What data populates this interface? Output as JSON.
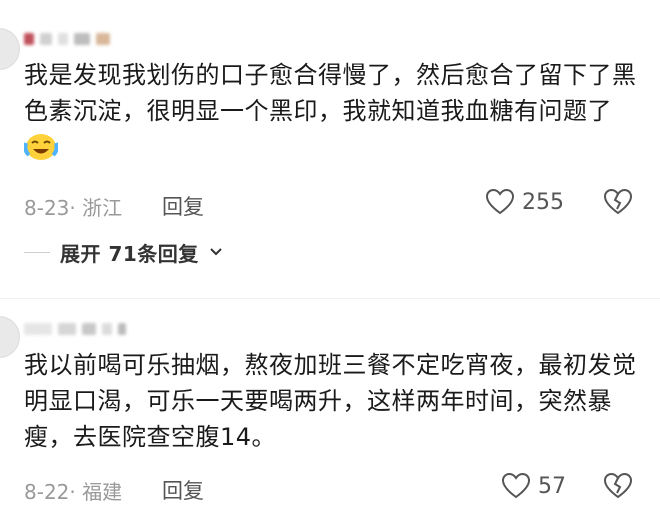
{
  "comments": [
    {
      "text": "我是发现我划伤的口子愈合得慢了，然后愈合了留下了黑色素沉淀，很明显一个黑印，我就知道我血糖有问题了",
      "date_location": "8-23· 浙江",
      "reply_label": "回复",
      "likes": "255",
      "expand_label": "展开 71条回复"
    },
    {
      "text": "我以前喝可乐抽烟，熬夜加班三餐不定吃宵夜，最初发觉明显口渴，可乐一天要喝两升，这样两年时间，突然暴瘦，去医院查空腹14。",
      "date_location": "8-22· 福建",
      "reply_label": "回复",
      "likes": "57"
    }
  ],
  "colors": {
    "text": "#1a1a1a",
    "meta": "#999999",
    "icon": "#555555"
  }
}
